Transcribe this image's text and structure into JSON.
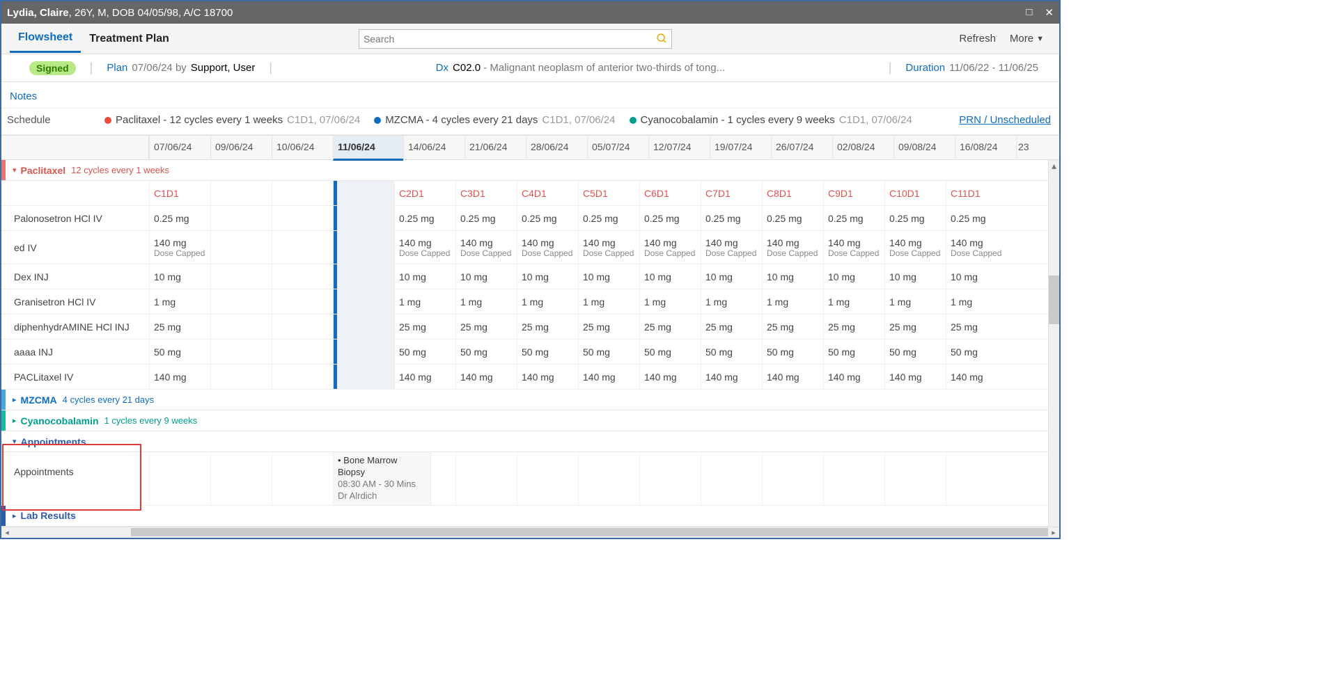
{
  "titlebar": {
    "name": "Lydia, Claire",
    "meta": ", 26Y, M, DOB 04/05/98, A/C 18700"
  },
  "tabs": {
    "flowsheet": "Flowsheet",
    "treatment": "Treatment Plan"
  },
  "search": {
    "placeholder": "Search"
  },
  "actions": {
    "refresh": "Refresh",
    "more": "More"
  },
  "info": {
    "status": "Signed",
    "plan_label": "Plan",
    "plan_date": "07/06/24 by",
    "plan_user": "Support, User",
    "dx_label": "Dx",
    "dx_code": "C02.0",
    "dx_text": " - Malignant neoplasm of anterior two-thirds of tong...",
    "duration_label": "Duration",
    "duration_value": "11/06/22 - 11/06/25"
  },
  "notes": "Notes",
  "schedule": {
    "title": "Schedule",
    "leg1": "Paclitaxel - 12 cycles every 1 weeks",
    "leg1sub": "C1D1, 07/06/24",
    "leg2": "MZCMA - 4 cycles every 21 days",
    "leg2sub": "C1D1, 07/06/24",
    "leg3": "Cyanocobalamin - 1 cycles every 9 weeks",
    "leg3sub": "C1D1, 07/06/24",
    "prn": "PRN / Unscheduled"
  },
  "dates": [
    "07/06/24",
    "09/06/24",
    "10/06/24",
    "11/06/24",
    "14/06/24",
    "21/06/24",
    "28/06/24",
    "05/07/24",
    "12/07/24",
    "19/07/24",
    "26/07/24",
    "02/08/24",
    "09/08/24",
    "16/08/24"
  ],
  "dates_trail": "23",
  "groups": {
    "paclitaxel": {
      "name": "Paclitaxel",
      "sub": "12 cycles every 1 weeks"
    },
    "mzcma": {
      "name": "MZCMA",
      "sub": "4 cycles every 21 days"
    },
    "cyano": {
      "name": "Cyanocobalamin",
      "sub": "1 cycles every 9 weeks"
    },
    "appt": {
      "name": "Appointments"
    },
    "lab": {
      "name": "Lab Results"
    }
  },
  "cycle_labels": [
    "C1D1",
    "",
    "",
    "",
    "C2D1",
    "C3D1",
    "C4D1",
    "C5D1",
    "C6D1",
    "C7D1",
    "C8D1",
    "C9D1",
    "C10D1",
    "C11D1"
  ],
  "drugs": [
    {
      "name": "Palonosetron HCl IV",
      "dose": "0.25 mg"
    },
    {
      "name": "ed IV",
      "dose": "140 mg",
      "sub": "Dose Capped"
    },
    {
      "name": "Dex INJ",
      "dose": "10 mg"
    },
    {
      "name": "Granisetron HCl IV",
      "dose": "1 mg"
    },
    {
      "name": "diphenhydrAMINE HCl INJ",
      "dose": "25 mg"
    },
    {
      "name": "aaaa INJ",
      "dose": "50 mg"
    },
    {
      "name": "PACLitaxel IV",
      "dose": "140 mg"
    }
  ],
  "appt_label": "Appointments",
  "appt": {
    "title": "Bone Marrow Biopsy",
    "time": "08:30 AM - 30 Mins",
    "who": "Dr Alrdich"
  }
}
